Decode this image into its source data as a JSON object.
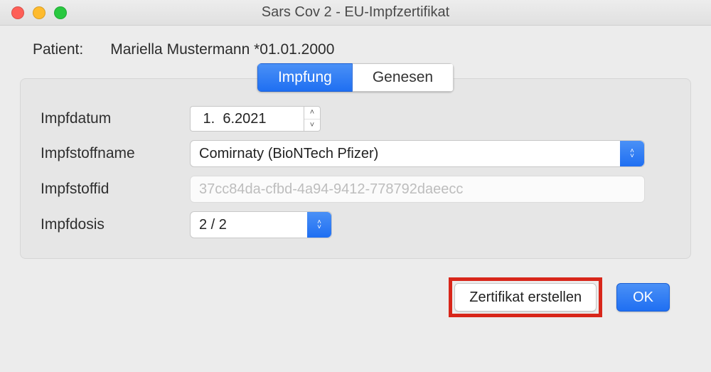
{
  "window": {
    "title": "Sars Cov 2 - EU-Impfzertifikat"
  },
  "patient": {
    "label": "Patient:",
    "value": "Mariella Mustermann *01.01.2000"
  },
  "tabs": {
    "impfung": "Impfung",
    "genesen": "Genesen"
  },
  "form": {
    "impfdatum": {
      "label": "Impfdatum",
      "value": " 1.  6.2021"
    },
    "impfstoffname": {
      "label": "Impfstoffname",
      "value": "Comirnaty (BioNTech Pfizer)"
    },
    "impfstoffid": {
      "label": "Impfstoffid",
      "value": "37cc84da-cfbd-4a94-9412-778792daeecc"
    },
    "impfdosis": {
      "label": "Impfdosis",
      "value": "2 / 2"
    }
  },
  "buttons": {
    "create_certificate": "Zertifikat erstellen",
    "ok": "OK"
  }
}
